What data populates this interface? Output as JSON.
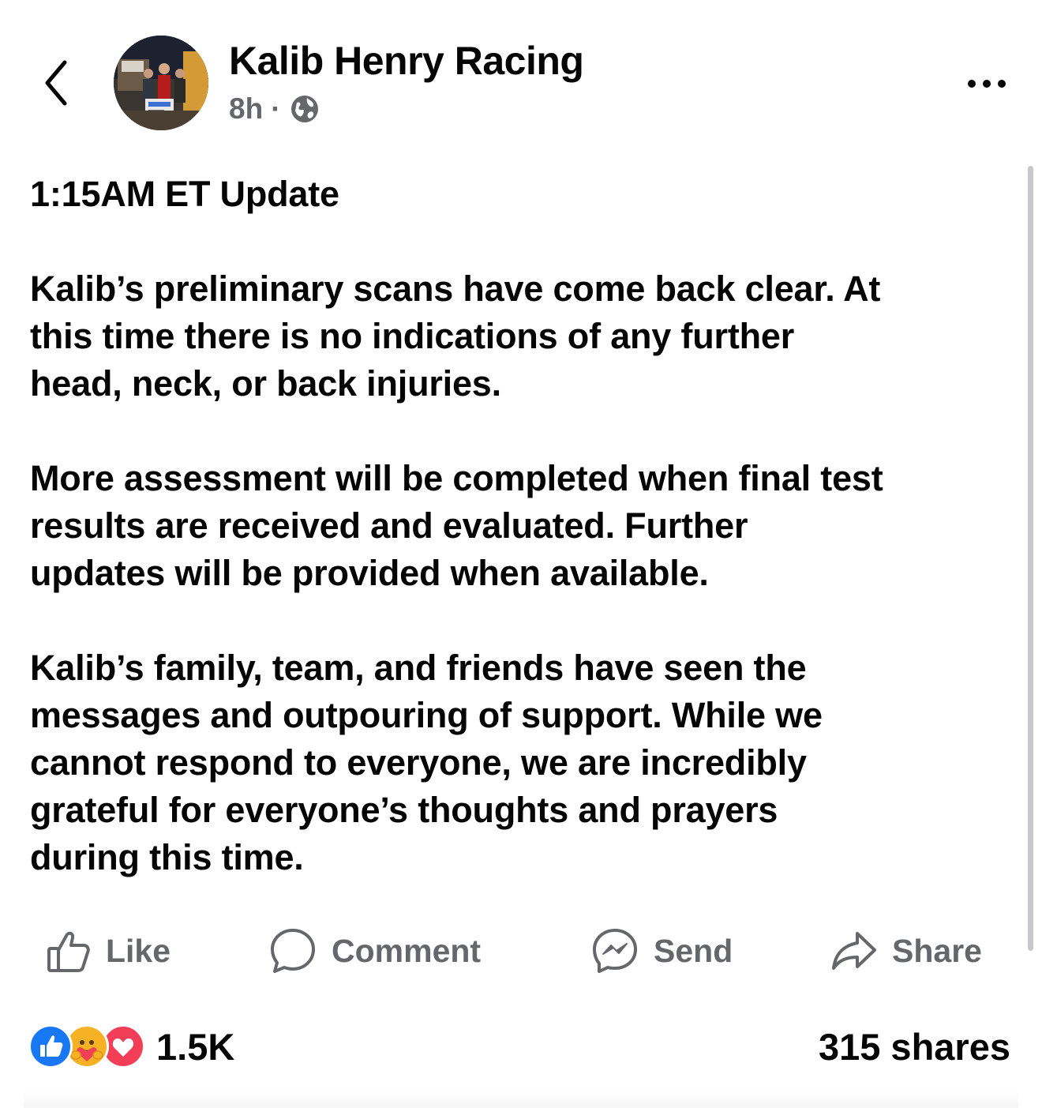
{
  "header": {
    "author_name": "Kalib Henry Racing",
    "timestamp": "8h",
    "separator": "·",
    "audience_icon": "globe-icon",
    "back_icon": "chevron-left-icon",
    "more_icon": "more-horizontal-icon",
    "avatar": "profile-photo"
  },
  "post": {
    "paragraphs": [
      "1:15AM ET Update",
      "Kalib’s preliminary scans have come back clear. At\nthis time there is no indications of any further\nhead, neck, or back injuries.",
      "More assessment will be completed when final test\nresults are received and evaluated. Further\nupdates will be provided when available.",
      "Kalib’s family, team, and friends have seen the\nmessages and outpouring of support. While we\ncannot respond to everyone, we are incredibly\ngrateful for everyone’s thoughts and prayers\nduring this time."
    ]
  },
  "actions": {
    "like": {
      "label": "Like",
      "icon": "thumbs-up-icon"
    },
    "comment": {
      "label": "Comment",
      "icon": "comment-bubble-icon"
    },
    "send": {
      "label": "Send",
      "icon": "messenger-icon"
    },
    "share": {
      "label": "Share",
      "icon": "share-arrow-icon"
    }
  },
  "stats": {
    "reaction_icons": [
      "like-reaction-icon",
      "care-reaction-icon",
      "love-reaction-icon"
    ],
    "reaction_count": "1.5K",
    "shares": "315 shares"
  },
  "colors": {
    "text": "#050505",
    "secondary_text": "#65676b",
    "like_blue": "#1877f2",
    "love_red": "#f33e58",
    "care_yellow": "#f7b125"
  }
}
